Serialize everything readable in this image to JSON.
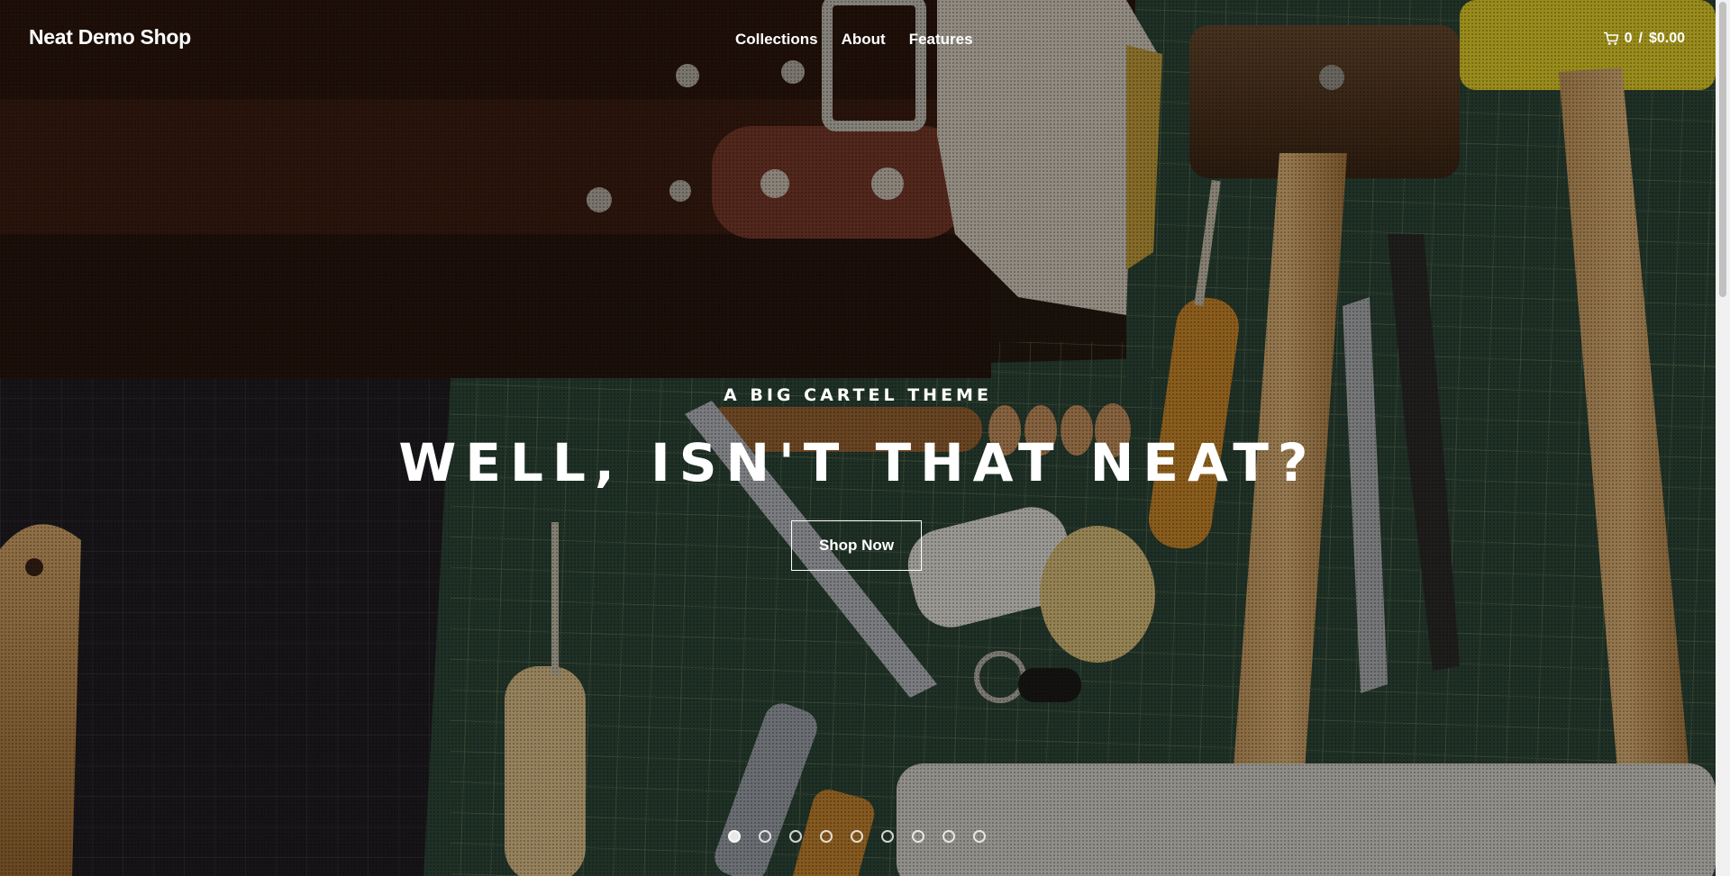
{
  "header": {
    "logo": "Neat Demo Shop",
    "nav": [
      {
        "label": "Collections"
      },
      {
        "label": "About"
      },
      {
        "label": "Features"
      }
    ],
    "cart": {
      "icon": "cart-icon",
      "count": "0",
      "separator": "/",
      "total": "$0.00"
    }
  },
  "hero": {
    "subtitle": "A BIG CARTEL THEME",
    "headline": "WELL, ISN'T THAT NEAT?",
    "cta_label": "Shop Now",
    "slide_count": 9,
    "active_slide": 1
  },
  "colors": {
    "text": "#ffffff",
    "cutting_mat": "#2c4a3c",
    "leather": "#3a1f14"
  }
}
